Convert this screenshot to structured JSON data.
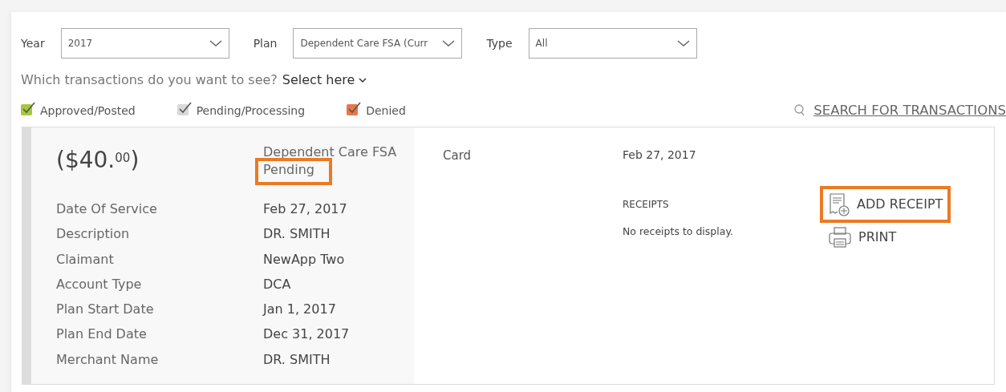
{
  "filters": [
    {
      "label": "Year",
      "value": "2017"
    },
    {
      "label": "Plan",
      "value": "Dependent Care FSA (Curr"
    },
    {
      "label": "Type",
      "value": "All"
    }
  ],
  "question": {
    "text": "Which transactions do you want to see?",
    "select": "Select here"
  },
  "legend": [
    {
      "label": "Approved/Posted",
      "checked": true,
      "color": "#a6c83c"
    },
    {
      "label": "Pending/Processing",
      "checked": true,
      "color": "#d9d9d9"
    },
    {
      "label": "Denied",
      "checked": true,
      "color": "#e9774a"
    }
  ],
  "search_link": "SEARCH FOR TRANSACTIONS",
  "transaction": {
    "amount": "($40.$^{00}$)",
    "plan": "Dependent Care FSA",
    "status": {
      "text": "Pending",
      "highlighted": true
    },
    "method": "Card",
    "date": "Feb 27, 2017",
    "details": [
      {
        "label": "Date Of Service",
        "value": "Feb 27, 2017"
      },
      {
        "label": "Description",
        "value": "DR. SMITH"
      },
      {
        "label": "Claimant",
        "value": "NewApp Two"
      },
      {
        "label": "Account Type",
        "value": "DCA"
      },
      {
        "label": "Plan Start Date",
        "value": "Jan 1, 2017"
      },
      {
        "label": "Plan End Date",
        "value": "Dec 31, 2017"
      },
      {
        "label": "Merchant Name",
        "value": "DR. SMITH"
      }
    ],
    "receipts": {
      "heading": "RECEIPTS",
      "empty": "No receipts to display."
    },
    "actions": [
      {
        "kind": "add-receipt",
        "label": "ADD RECEIPT",
        "highlighted": true
      },
      {
        "kind": "print",
        "label": "PRINT",
        "highlighted": false
      }
    ]
  }
}
